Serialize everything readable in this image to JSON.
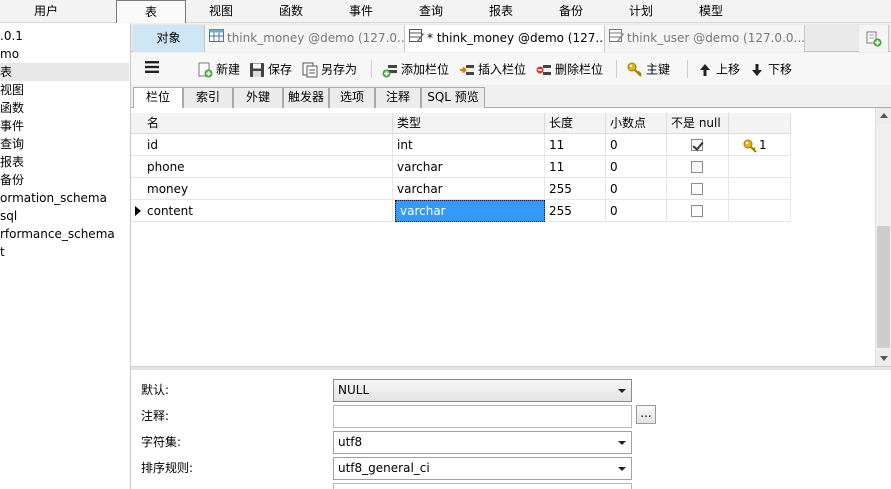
{
  "menu": {
    "items": [
      {
        "label": "用户"
      },
      {
        "label": "表"
      },
      {
        "label": "视图"
      },
      {
        "label": "函数"
      },
      {
        "label": "事件"
      },
      {
        "label": "查询"
      },
      {
        "label": "报表"
      },
      {
        "label": "备份"
      },
      {
        "label": "计划"
      },
      {
        "label": "模型"
      }
    ]
  },
  "sidebar": {
    "items": [
      {
        "label": ".0.1"
      },
      {
        "label": "mo"
      },
      {
        "label": "表"
      },
      {
        "label": "视图"
      },
      {
        "label": "函数"
      },
      {
        "label": "事件"
      },
      {
        "label": "查询"
      },
      {
        "label": "报表"
      },
      {
        "label": "备份"
      },
      {
        "label": "ormation_schema"
      },
      {
        "label": "sql"
      },
      {
        "label": "rformance_schema"
      },
      {
        "label": "t"
      }
    ]
  },
  "tabs": {
    "objects_label": "对象",
    "doc_tabs": [
      {
        "label": "think_money @demo (127.0...."
      },
      {
        "label": "* think_money @demo (127...."
      },
      {
        "label": "think_user @demo (127.0.0...."
      }
    ]
  },
  "toolbar": {
    "new_label": "新建",
    "save_label": "保存",
    "save_as_label": "另存为",
    "add_field_label": "添加栏位",
    "insert_field_label": "插入栏位",
    "delete_field_label": "删除栏位",
    "primary_key_label": "主键",
    "move_up_label": "上移",
    "move_down_label": "下移"
  },
  "subtabs": [
    {
      "label": "栏位"
    },
    {
      "label": "索引"
    },
    {
      "label": "外键"
    },
    {
      "label": "触发器"
    },
    {
      "label": "选项"
    },
    {
      "label": "注释"
    },
    {
      "label": "SQL 预览"
    }
  ],
  "grid": {
    "columns": [
      "名",
      "类型",
      "长度",
      "小数点",
      "不是 null",
      ""
    ],
    "rows": [
      {
        "name": "id",
        "type": "int",
        "length": "11",
        "decimals": "0",
        "not_null": true,
        "key": "1"
      },
      {
        "name": "phone",
        "type": "varchar",
        "length": "11",
        "decimals": "0",
        "not_null": false,
        "key": ""
      },
      {
        "name": "money",
        "type": "varchar",
        "length": "255",
        "decimals": "0",
        "not_null": false,
        "key": ""
      },
      {
        "name": "content",
        "type": "varchar",
        "length": "255",
        "decimals": "0",
        "not_null": false,
        "key": ""
      }
    ]
  },
  "properties": {
    "default_label": "默认:",
    "default_value": "NULL",
    "comment_label": "注释:",
    "comment_value": "",
    "comment_button": "...",
    "charset_label": "字符集:",
    "charset_value": "utf8",
    "collation_label": "排序规则:",
    "collation_value": "utf8_general_ci"
  },
  "colors": {
    "selection": "#3399ff",
    "objects_tab_bg": "#cfe6f7",
    "key_icon": "#d4a017"
  }
}
